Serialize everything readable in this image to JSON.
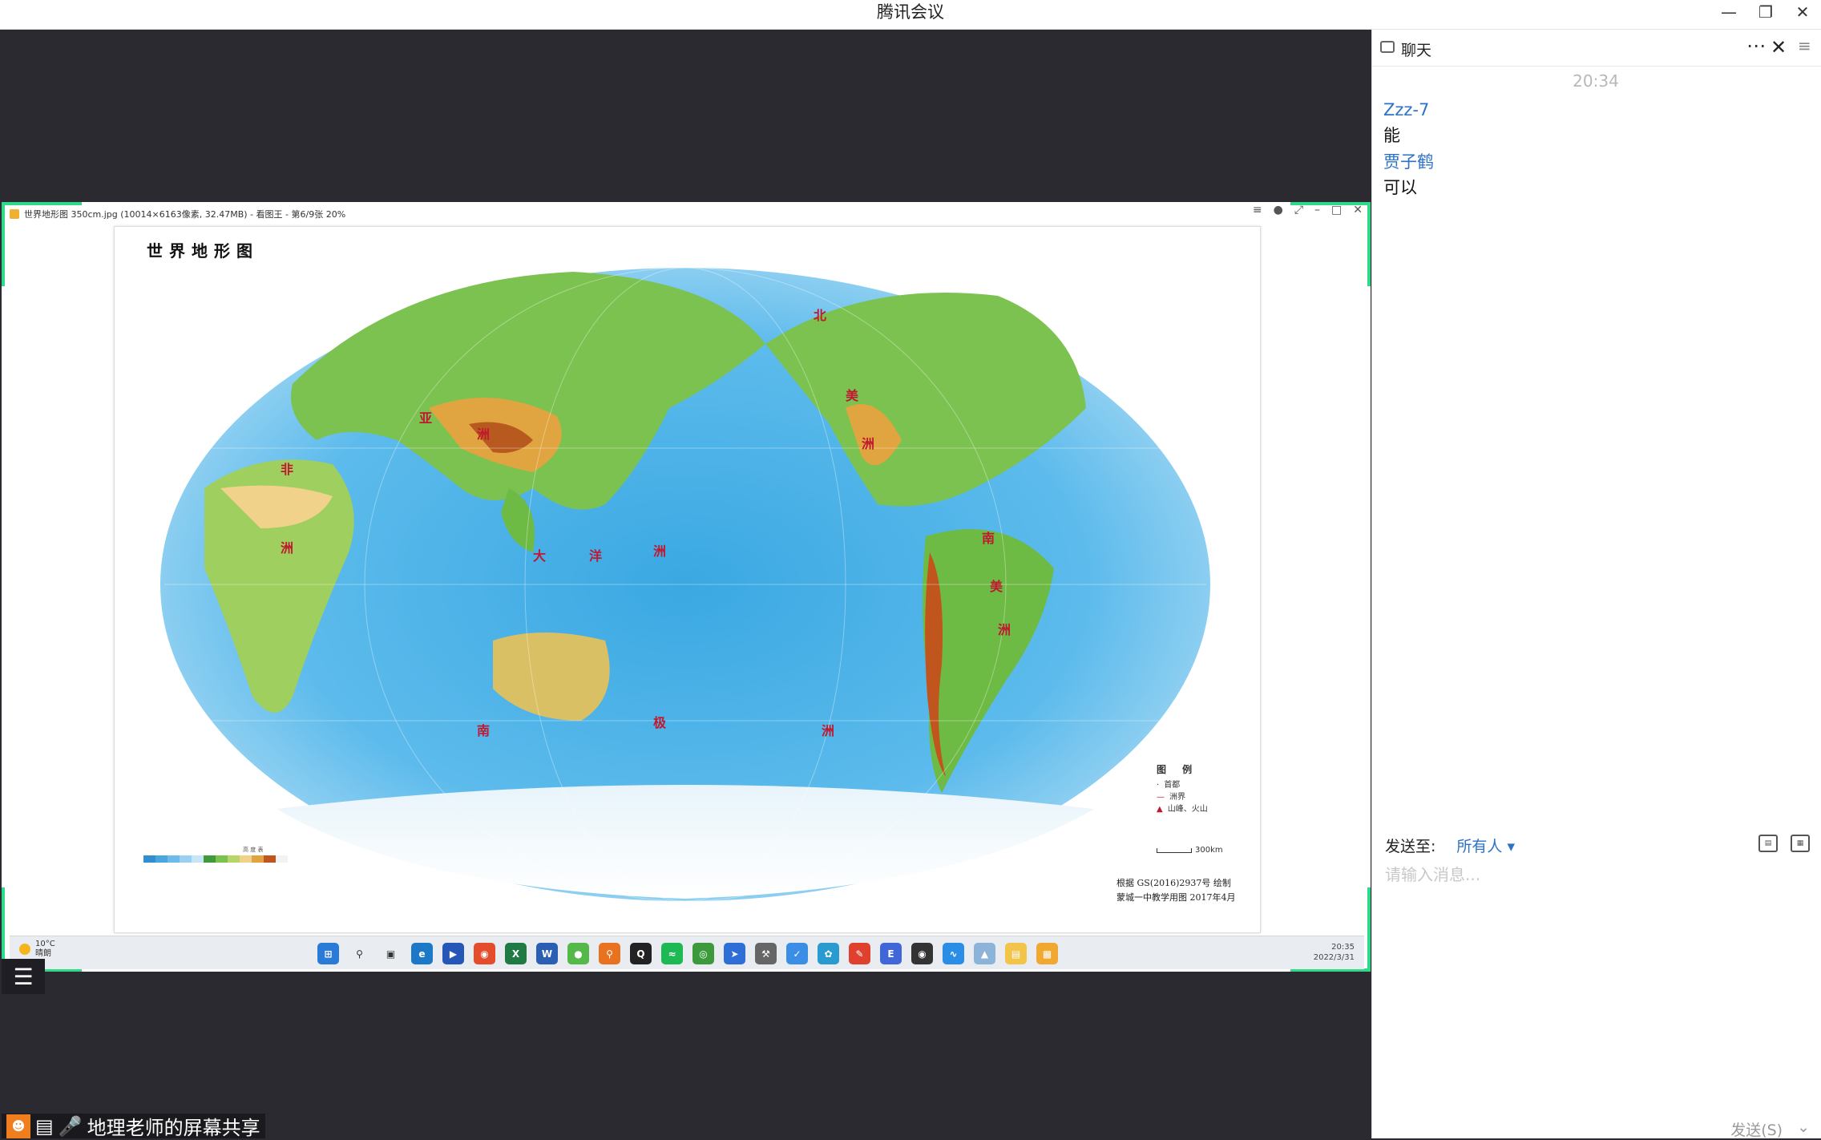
{
  "window": {
    "title": "腾讯会议",
    "min_icon": "minimize-icon",
    "restore_icon": "restore-icon",
    "close_icon": "close-icon"
  },
  "share": {
    "viewer_title": "世界地形图 350cm.jpg  (10014×6163像素, 32.47MB) - 看图王 - 第6/9张 20%",
    "map": {
      "title": "世界地形图",
      "legend_title": "图  例",
      "legend_items": [
        "首都",
        "洲界",
        "山峰、火山"
      ],
      "scale_label": "300km",
      "credit_line1": "根据 GS(2016)2937号  绘制",
      "credit_line2": "蒙城一中教学用图  2017年4月",
      "elevation_label": "高 度 表"
    },
    "taskbar": {
      "weather_temp": "10°C",
      "weather_text": "晴朗",
      "clock_time": "20:35",
      "clock_date": "2022/3/31"
    }
  },
  "presenter": {
    "label": "地理老师的屏幕共享"
  },
  "chat": {
    "title": "聊天",
    "timestamp": "20:34",
    "messages": [
      {
        "sender": "Zzz-7",
        "text": "能"
      },
      {
        "sender": "贾子鹤",
        "text": "可以"
      }
    ],
    "send_to_label": "发送至:",
    "send_to_value": "所有人",
    "input_placeholder": "请输入消息...",
    "send_button": "发送(S)"
  },
  "colors": {
    "accent": "#2c72c7",
    "share_border": "#2fd98a",
    "stage_bg": "#2b2a30"
  }
}
